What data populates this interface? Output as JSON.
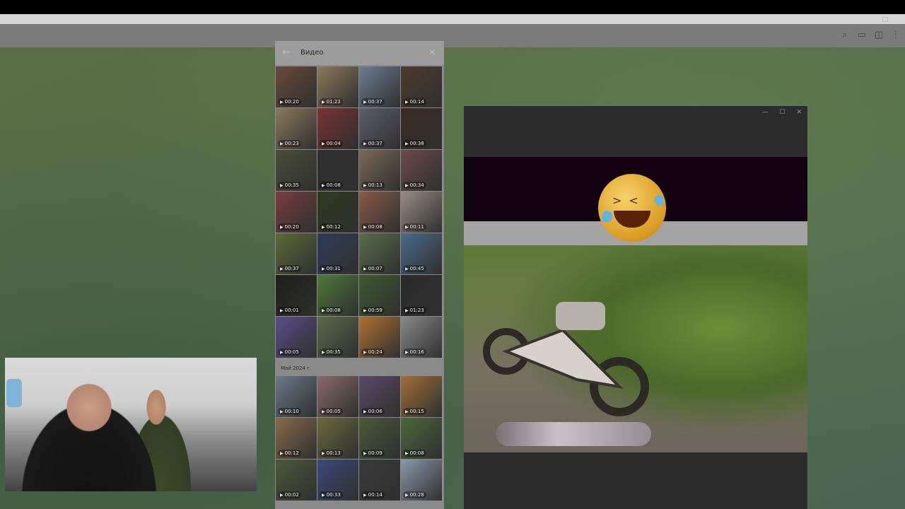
{
  "window": {
    "topbar": "",
    "chat_icons": [
      "search-icon",
      "chat-icon",
      "sidebar-icon",
      "more-icon"
    ]
  },
  "media_panel": {
    "title": "Видео",
    "back_icon": "arrow-left-icon",
    "close_icon": "close-icon",
    "section_label": "Май 2024 г.",
    "tiles_top": [
      {
        "d": "00:20",
        "c": "#6b4a38"
      },
      {
        "d": "01:23",
        "c": "#8c7a5a"
      },
      {
        "d": "00:37",
        "c": "#6d7e92"
      },
      {
        "d": "00:14",
        "c": "#4b3b2e"
      },
      {
        "d": "00:23",
        "c": "#8b7a5b"
      },
      {
        "d": "00:04",
        "c": "#7a3232"
      },
      {
        "d": "00:37",
        "c": "#5e5e6e"
      },
      {
        "d": "00:38",
        "c": "#3b2b24"
      },
      {
        "d": "00:35",
        "c": "#4a4e3a"
      },
      {
        "d": "00:08",
        "c": "#2f2f2f"
      },
      {
        "d": "00:13",
        "c": "#7a6a58"
      },
      {
        "d": "00:34",
        "c": "#6b4a4a"
      },
      {
        "d": "00:20",
        "c": "#7a3d3d"
      },
      {
        "d": "00:12",
        "c": "#2f3a20"
      },
      {
        "d": "00:08",
        "c": "#8a5a48"
      },
      {
        "d": "00:11",
        "c": "#9a8c84"
      },
      {
        "d": "00:37",
        "c": "#5d6a3a"
      },
      {
        "d": "00:31",
        "c": "#2f3c5a"
      },
      {
        "d": "00:07",
        "c": "#5a6e4a"
      },
      {
        "d": "00:45",
        "c": "#4a6a8a"
      },
      {
        "d": "00:01",
        "c": "#1e1e1a"
      },
      {
        "d": "00:08",
        "c": "#4e7a3a"
      },
      {
        "d": "00:59",
        "c": "#3d5a2f"
      },
      {
        "d": "01:23",
        "c": "#2a2a2a"
      },
      {
        "d": "00:05",
        "c": "#5a4e8a"
      },
      {
        "d": "00:35",
        "c": "#5a6a4a"
      },
      {
        "d": "00:24",
        "c": "#b07030"
      },
      {
        "d": "00:16",
        "c": "#8a8a8a"
      }
    ],
    "tiles_bottom": [
      {
        "d": "00:10",
        "c": "#6a7a8a"
      },
      {
        "d": "00:05",
        "c": "#8a6a6a"
      },
      {
        "d": "00:06",
        "c": "#5a4a6a"
      },
      {
        "d": "00:15",
        "c": "#a07038"
      },
      {
        "d": "00:12",
        "c": "#8a6a4a"
      },
      {
        "d": "00:13",
        "c": "#6a6a3a"
      },
      {
        "d": "00:09",
        "c": "#4a5a3a"
      },
      {
        "d": "00:08",
        "c": "#4a6a3a"
      },
      {
        "d": "00:02",
        "c": "#4a5a3a"
      },
      {
        "d": "00:33",
        "c": "#3a4a7a"
      },
      {
        "d": "00:14",
        "c": "#3a3a3a"
      },
      {
        "d": "00:28",
        "c": "#8a9aaa"
      }
    ]
  },
  "viewer": {
    "minimize_icon": "minimize-icon",
    "maximize_icon": "maximize-icon",
    "close_icon": "close-icon",
    "emoji": "rolling-on-floor-laughing-emoji"
  },
  "webcam": {
    "label": ""
  }
}
